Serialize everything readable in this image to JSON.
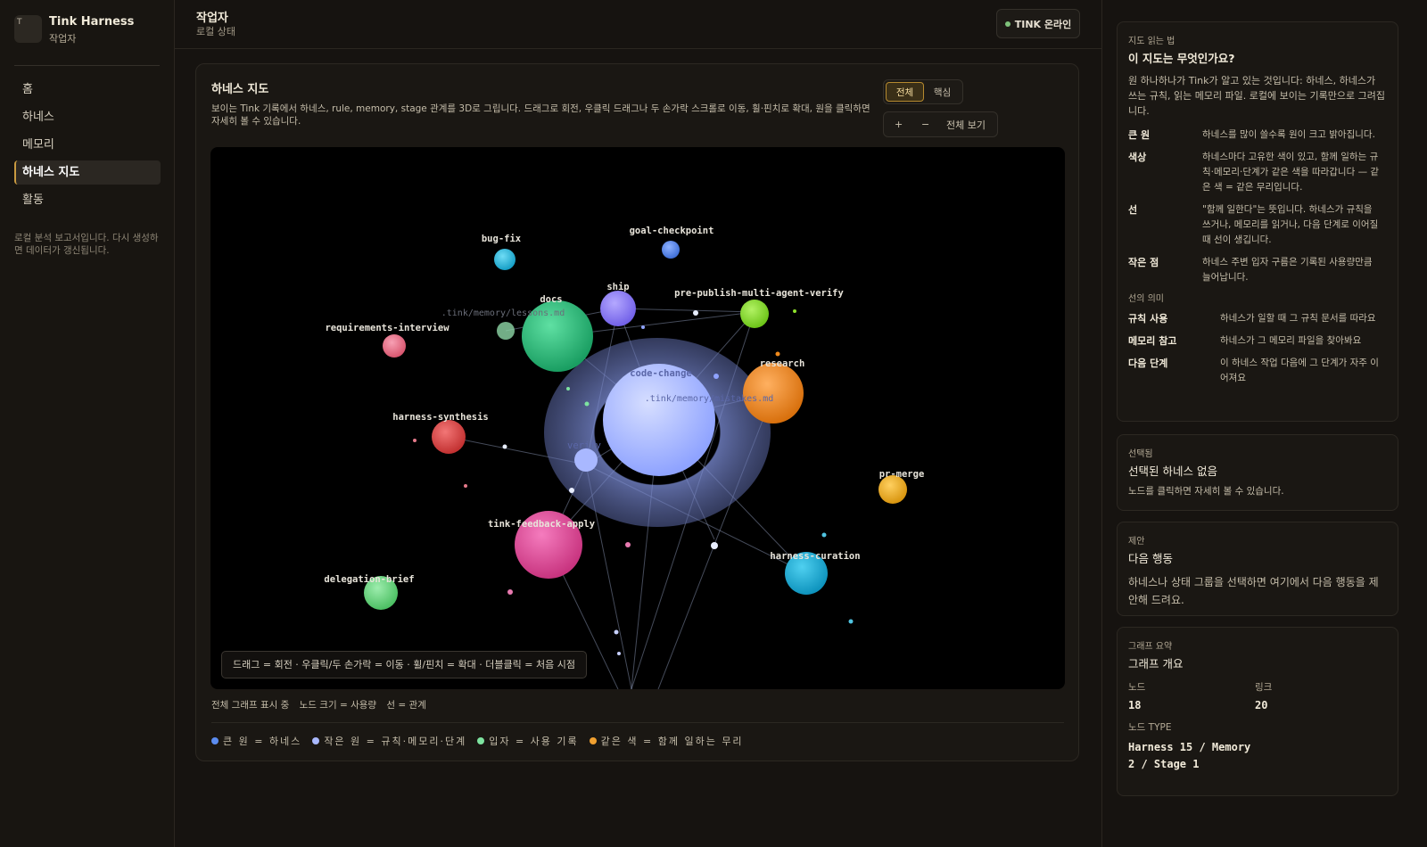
{
  "sidebar": {
    "logo_letter": "T",
    "brand_title": "Tink Harness",
    "brand_subtitle": "작업자",
    "nav": [
      "홈",
      "하네스",
      "메모리",
      "하네스 지도",
      "활동"
    ],
    "active_index": 3,
    "note": "로컬 분석 보고서입니다. 다시 생성하면 데이터가 갱신됩니다."
  },
  "header": {
    "title": "작업자",
    "subtitle": "로컬 상태",
    "status_label": "TINK 온라인",
    "status_color": "#7ec27b"
  },
  "map": {
    "title": "하네스 지도",
    "description": "보이는 Tink 기록에서 하네스, rule, memory, stage 관계를 3D로 그립니다. 드래그로 회전, 우클릭 드래그나 두 손가락 스크롤로 이동, 휠·핀치로 확대, 원을 클릭하면 자세히 볼 수 있습니다.",
    "toggle_all": "전체",
    "toggle_core": "핵심",
    "zoom_in": "+",
    "zoom_out": "−",
    "zoom_fit": "전체 보기",
    "hint": "드래그 = 회전 · 우클릭/두 손가락 = 이동 · 휠/핀치 = 확대 · 더블클릭 = 처음 시점",
    "status": [
      "전체 그래프 표시 중",
      "노드 크기 = 사용량",
      "선 = 관계"
    ],
    "legend": [
      {
        "label": "큰 원 = 하네스",
        "color": "#5b8cf0"
      },
      {
        "label": "작은 원 = 규칙·메모리·단계",
        "color": "#a9b8ff"
      },
      {
        "label": "입자 = 사용 기록",
        "color": "#7ee3a0"
      },
      {
        "label": "같은 색 = 함께 일하는 무리",
        "color": "#f0a030"
      }
    ],
    "nodes": [
      {
        "id": "code-change",
        "label": "code-change",
        "color": "#a9b8ff",
        "kind": "harness"
      },
      {
        "id": "docs",
        "label": "docs",
        "color": "#2ec27e",
        "kind": "harness"
      },
      {
        "id": "research",
        "label": "research",
        "color": "#f08a1c",
        "kind": "harness"
      },
      {
        "id": "tink-feedback-apply",
        "label": "tink-feedback-apply",
        "color": "#ea4fa0",
        "kind": "harness"
      },
      {
        "id": "harness-curation",
        "label": "harness-curation",
        "color": "#1bb3e0",
        "kind": "harness"
      },
      {
        "id": "ship",
        "label": "ship",
        "color": "#8f7bff",
        "kind": "harness"
      },
      {
        "id": "pre-publish-multi-agent-verify",
        "label": "pre-publish-multi-agent-verify",
        "color": "#8fe22c",
        "kind": "harness"
      },
      {
        "id": "harness-synthesis",
        "label": "harness-synthesis",
        "color": "#e24a4a",
        "kind": "harness"
      },
      {
        "id": "delegation-brief",
        "label": "delegation-brief",
        "color": "#6fdc85",
        "kind": "harness"
      },
      {
        "id": "pr-merge",
        "label": "pr-merge",
        "color": "#f0b62a",
        "kind": "harness"
      },
      {
        "id": "bug-fix",
        "label": "bug-fix",
        "color": "#2ec0e8",
        "kind": "harness"
      },
      {
        "id": "goal-checkpoint",
        "label": "goal-checkpoint",
        "color": "#5b8cf0",
        "kind": "harness"
      },
      {
        "id": "requirements-interview",
        "label": "requirements-interview",
        "color": "#ee6a8a",
        "kind": "harness"
      },
      {
        "id": "verify",
        "label": "verify",
        "color": "#a9b8ff",
        "kind": "stage"
      },
      {
        "id": "lessons-md",
        "label": ".tink/memory/lessons.md",
        "color": "#8fd8a8",
        "kind": "memory"
      },
      {
        "id": "mistakes-md",
        "label": ".tink/memory/mistakes.md",
        "color": "#a9b8ff",
        "kind": "memory"
      }
    ]
  },
  "guide": {
    "kicker": "지도 읽는 법",
    "title": "이 지도는 무엇인가요?",
    "intro": "원 하나하나가 Tink가 알고 있는 것입니다: 하네스, 하네스가 쓰는 규칙, 읽는 메모리 파일. 로컬에 보이는 기록만으로 그려집니다.",
    "defs": [
      {
        "term": "큰 원",
        "desc": "하네스를 많이 쓸수록 원이 크고 밝아집니다."
      },
      {
        "term": "색상",
        "desc": "하네스마다 고유한 색이 있고, 함께 일하는 규칙·메모리·단계가 같은 색을 따라갑니다 — 같은 색 = 같은 무리입니다."
      },
      {
        "term": "선",
        "desc": "\"함께 일한다\"는 뜻입니다. 하네스가 규칙을 쓰거나, 메모리를 읽거나, 다음 단계로 이어질 때 선이 생깁니다."
      },
      {
        "term": "작은 점",
        "desc": "하네스 주변 입자 구름은 기록된 사용량만큼 늘어납니다."
      }
    ],
    "lines_heading": "선의 의미",
    "line_defs": [
      {
        "term": "규칙 사용",
        "desc": "하네스가 일할 때 그 규칙 문서를 따라요"
      },
      {
        "term": "메모리 참고",
        "desc": "하네스가 그 메모리 파일을 찾아봐요"
      },
      {
        "term": "다음 단계",
        "desc": "이 하네스 작업 다음에 그 단계가 자주 이어져요"
      }
    ]
  },
  "selected": {
    "kicker": "선택됨",
    "title": "선택된 하네스 없음",
    "text": "노드를 클릭하면 자세히 볼 수 있습니다."
  },
  "suggest": {
    "kicker": "제안",
    "title": "다음 행동",
    "text": "하네스나 상태 그룹을 선택하면 여기에서 다음 행동을 제안해 드려요."
  },
  "summary": {
    "kicker": "그래프 요약",
    "title": "그래프 개요",
    "nodes_label": "노드",
    "nodes_value": "18",
    "links_label": "링크",
    "links_value": "20",
    "type_label": "노드 TYPE",
    "type_value": "Harness 15 / Memory 2 / Stage 1"
  }
}
